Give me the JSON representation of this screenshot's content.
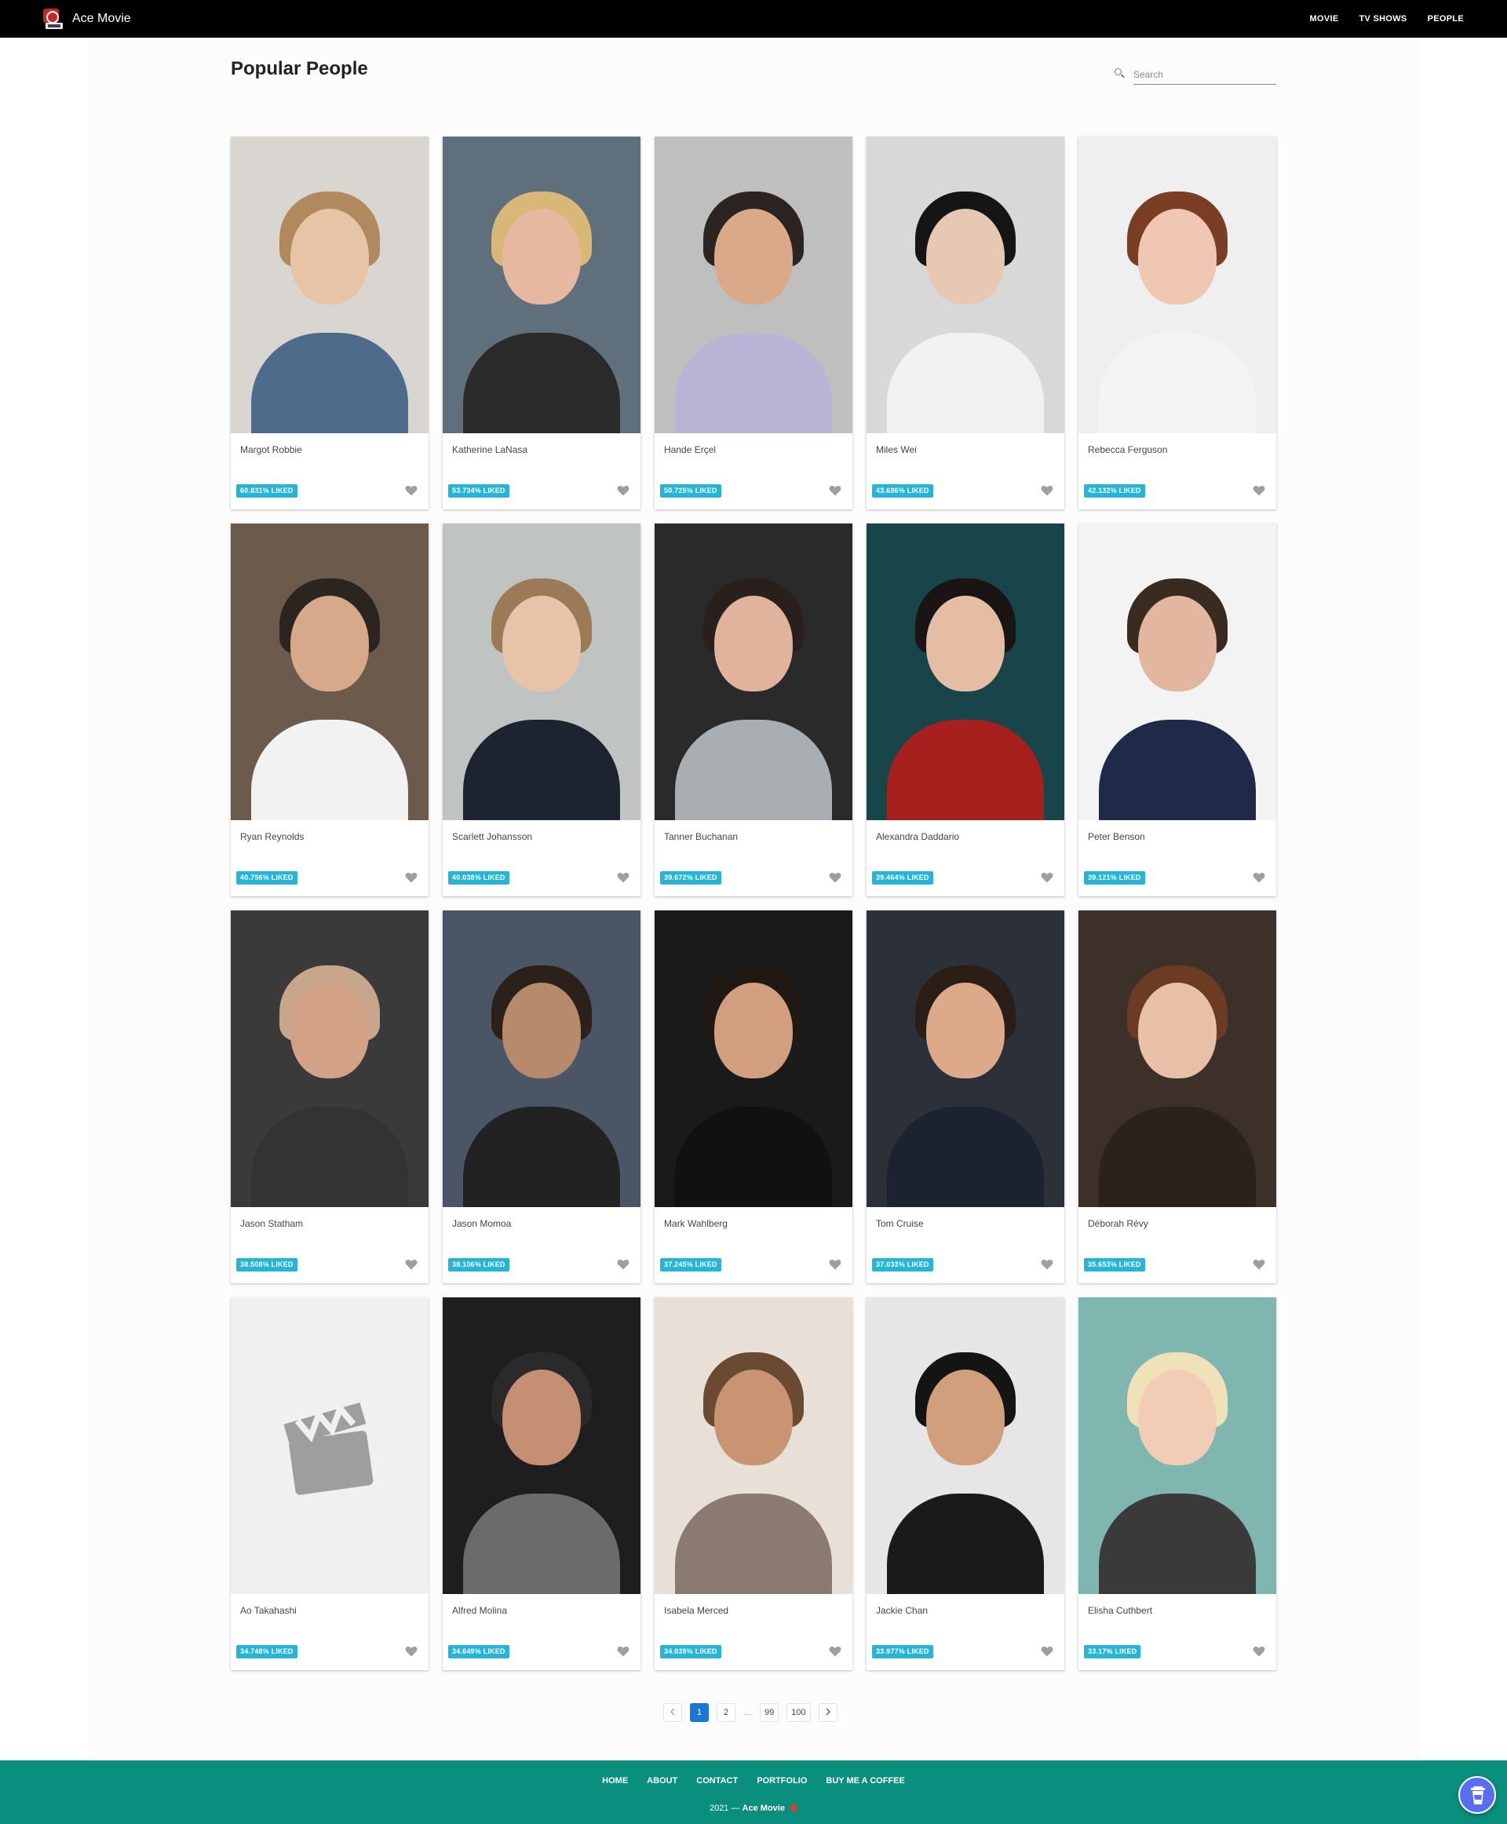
{
  "app": {
    "name": "Ace Movie"
  },
  "nav": {
    "items": [
      "MOVIE",
      "TV SHOWS",
      "PEOPLE"
    ]
  },
  "page": {
    "title": "Popular People"
  },
  "search": {
    "placeholder": "Search",
    "value": ""
  },
  "people": [
    {
      "name": "Margot Robbie",
      "liked": "60.831% LIKED",
      "has_photo": true
    },
    {
      "name": "Katherine LaNasa",
      "liked": "53.734% LIKED",
      "has_photo": true
    },
    {
      "name": "Hande Erçel",
      "liked": "50.725% LIKED",
      "has_photo": true
    },
    {
      "name": "Miles Wei",
      "liked": "43.686% LIKED",
      "has_photo": true
    },
    {
      "name": "Rebecca Ferguson",
      "liked": "42.132% LIKED",
      "has_photo": true
    },
    {
      "name": "Ryan Reynolds",
      "liked": "40.756% LIKED",
      "has_photo": true
    },
    {
      "name": "Scarlett Johansson",
      "liked": "40.038% LIKED",
      "has_photo": true
    },
    {
      "name": "Tanner Buchanan",
      "liked": "39.672% LIKED",
      "has_photo": true
    },
    {
      "name": "Alexandra Daddario",
      "liked": "39.464% LIKED",
      "has_photo": true
    },
    {
      "name": "Peter Benson",
      "liked": "39.121% LIKED",
      "has_photo": true
    },
    {
      "name": "Jason Statham",
      "liked": "38.508% LIKED",
      "has_photo": true
    },
    {
      "name": "Jason Momoa",
      "liked": "38.106% LIKED",
      "has_photo": true
    },
    {
      "name": "Mark Wahlberg",
      "liked": "37.245% LIKED",
      "has_photo": true
    },
    {
      "name": "Tom Cruise",
      "liked": "37.033% LIKED",
      "has_photo": true
    },
    {
      "name": "Déborah Révy",
      "liked": "35.653% LIKED",
      "has_photo": true
    },
    {
      "name": "Ao Takahashi",
      "liked": "34.748% LIKED",
      "has_photo": false
    },
    {
      "name": "Alfred Molina",
      "liked": "34.649% LIKED",
      "has_photo": true
    },
    {
      "name": "Isabela Merced",
      "liked": "34.039% LIKED",
      "has_photo": true
    },
    {
      "name": "Jackie Chan",
      "liked": "33.977% LIKED",
      "has_photo": true
    },
    {
      "name": "Elisha Cuthbert",
      "liked": "33.17% LIKED",
      "has_photo": true
    }
  ],
  "pagination": {
    "prev_icon": "chevron-left-icon",
    "pages": [
      "1",
      "2",
      "…",
      "99",
      "100"
    ],
    "current": "1",
    "next_icon": "chevron-right-icon"
  },
  "footer": {
    "links": [
      "HOME",
      "ABOUT",
      "CONTACT",
      "PORTFOLIO",
      "BUY ME A COFFEE"
    ],
    "year": "2021 —",
    "brand": "Ace Movie"
  },
  "colors": {
    "navbar": "#000000",
    "liked_badge": "#26b5d6",
    "active_page": "#1976d2",
    "footer": "#0a8f7f",
    "coffee_button": "#5b6cf4",
    "heart": "#9e9e9e"
  }
}
